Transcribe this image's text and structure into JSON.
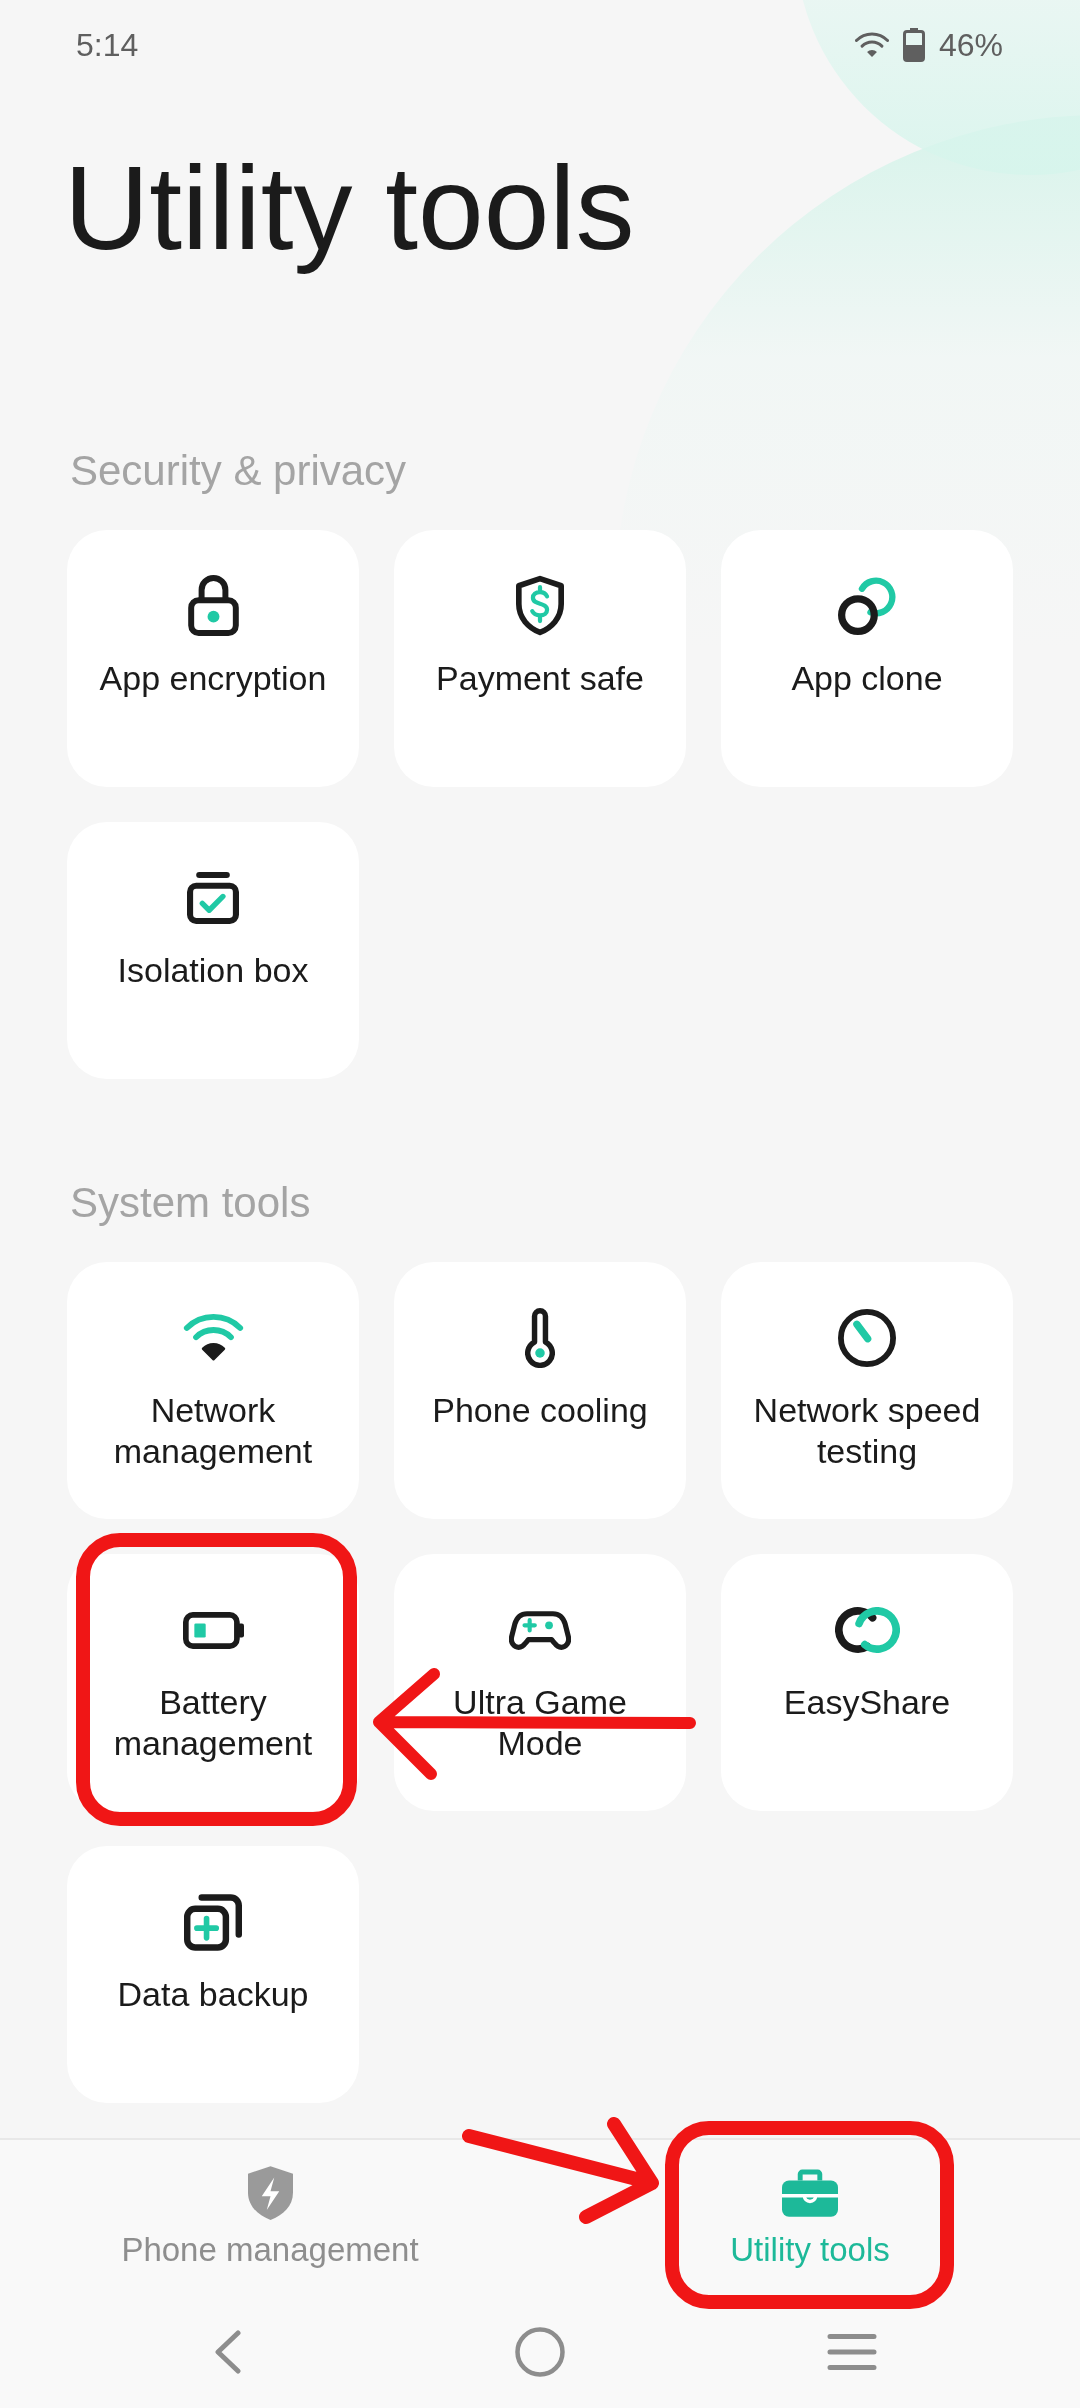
{
  "status_bar": {
    "time": "5:14",
    "battery": "46%"
  },
  "title": "Utility tools",
  "sections": [
    {
      "heading": "Security & privacy",
      "items": [
        {
          "label": "App encryption",
          "highlighted": false
        },
        {
          "label": "Payment safe",
          "highlighted": false
        },
        {
          "label": "App clone",
          "highlighted": false
        },
        {
          "label": "Isolation box",
          "highlighted": false
        }
      ]
    },
    {
      "heading": "System tools",
      "items": [
        {
          "label": "Network management",
          "highlighted": false
        },
        {
          "label": "Phone cooling",
          "highlighted": false
        },
        {
          "label": "Network speed testing",
          "highlighted": false
        },
        {
          "label": "Battery management",
          "highlighted": true
        },
        {
          "label": "Ultra Game Mode",
          "highlighted": false
        },
        {
          "label": "EasyShare",
          "highlighted": false
        },
        {
          "label": "Data backup",
          "highlighted": false
        }
      ]
    }
  ],
  "bottom_nav": {
    "tabs": [
      {
        "label": "Phone management",
        "selected": false,
        "highlighted": false
      },
      {
        "label": "Utility tools",
        "selected": true,
        "highlighted": true
      }
    ]
  }
}
